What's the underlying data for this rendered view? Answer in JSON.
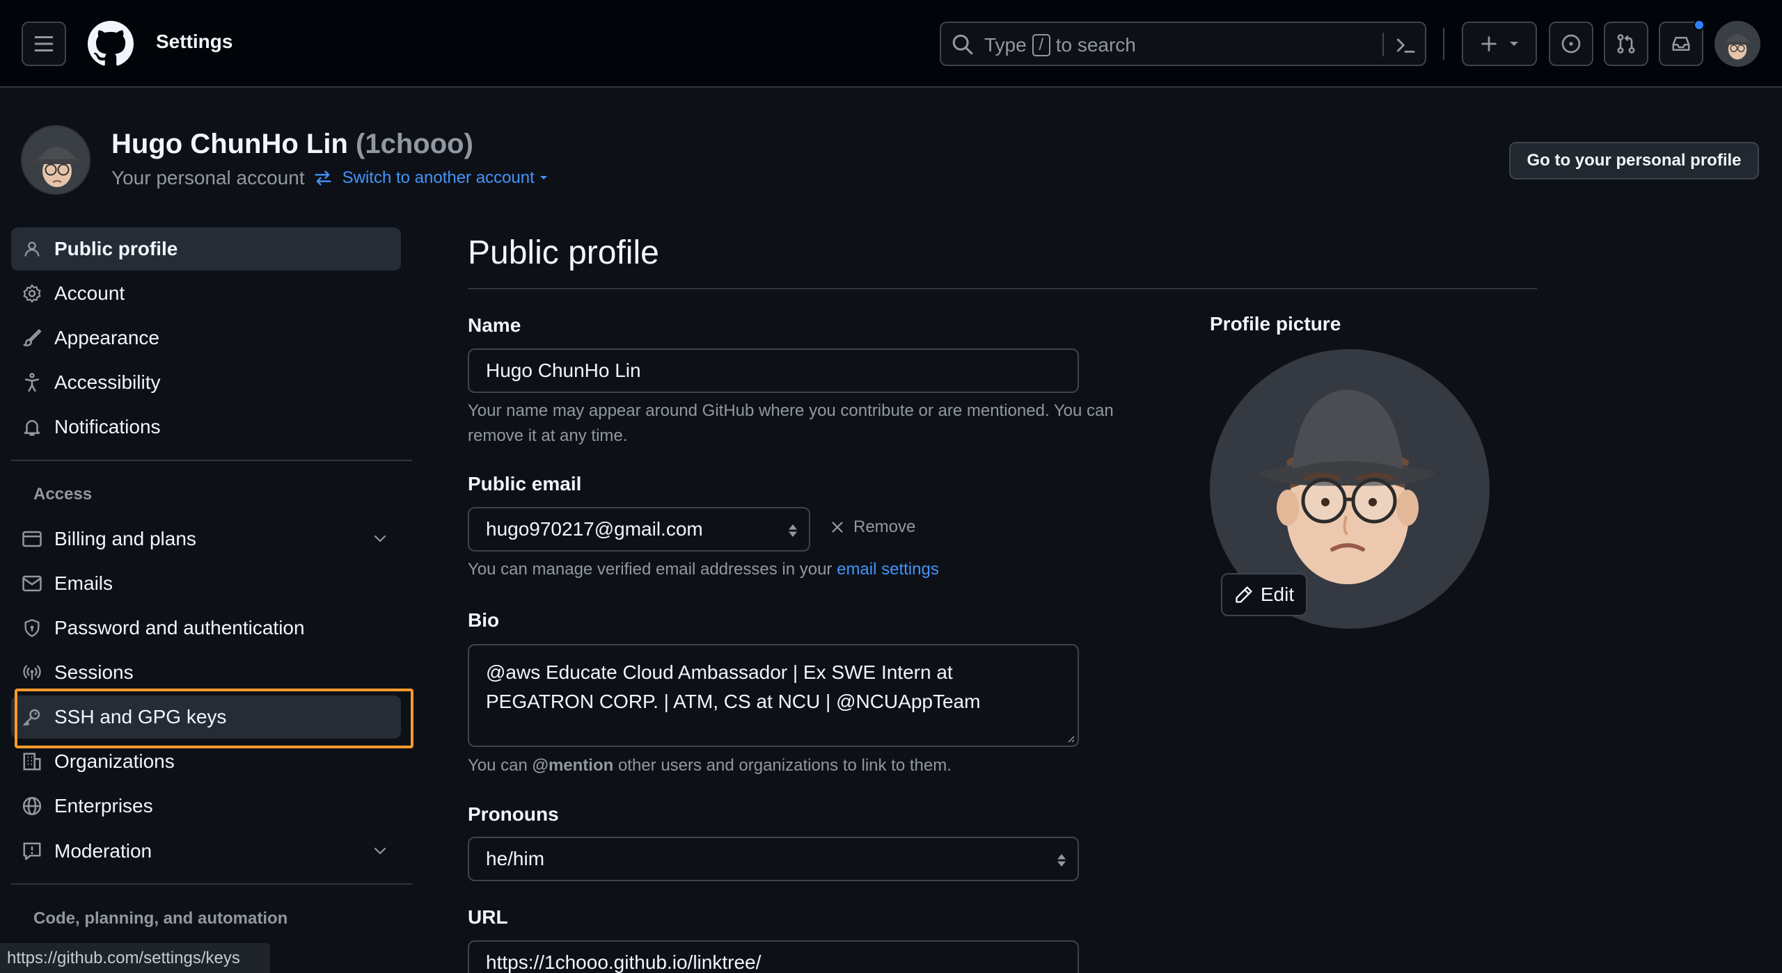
{
  "header": {
    "app_title": "Settings",
    "search_prefix": "Type",
    "search_key": "/",
    "search_suffix": "to search",
    "icons": [
      "menu-icon",
      "github-logo-icon",
      "search-icon",
      "command-palette-icon",
      "plus-icon",
      "issues-icon",
      "pull-requests-icon",
      "inbox-icon"
    ]
  },
  "account": {
    "name": "Hugo ChunHo Lin",
    "handle": "(1chooo)",
    "subtitle": "Your personal account",
    "switch_label": "Switch to another account",
    "profile_button": "Go to your personal profile"
  },
  "sidebar": {
    "items": [
      {
        "label": "Public profile",
        "icon": "person-icon"
      },
      {
        "label": "Account",
        "icon": "gear-icon"
      },
      {
        "label": "Appearance",
        "icon": "paintbrush-icon"
      },
      {
        "label": "Accessibility",
        "icon": "accessibility-icon"
      },
      {
        "label": "Notifications",
        "icon": "bell-icon"
      }
    ],
    "access_heading": "Access",
    "access_items": [
      {
        "label": "Billing and plans",
        "icon": "credit-card-icon"
      },
      {
        "label": "Emails",
        "icon": "mail-icon"
      },
      {
        "label": "Password and authentication",
        "icon": "shield-icon"
      },
      {
        "label": "Sessions",
        "icon": "broadcast-icon"
      },
      {
        "label": "SSH and GPG keys",
        "icon": "key-icon"
      },
      {
        "label": "Organizations",
        "icon": "organization-icon"
      },
      {
        "label": "Enterprises",
        "icon": "globe-icon"
      },
      {
        "label": "Moderation",
        "icon": "report-icon"
      }
    ],
    "code_heading": "Code, planning, and automation"
  },
  "main": {
    "title": "Public profile",
    "name_label": "Name",
    "name_value": "Hugo ChunHo Lin",
    "name_note": "Your name may appear around GitHub where you contribute or are mentioned. You can remove it at any time.",
    "email_label": "Public email",
    "email_value": "hugo970217@gmail.com",
    "remove_label": "Remove",
    "email_note_prefix": "You can manage verified email addresses in your",
    "email_note_link": "email settings",
    "bio_label": "Bio",
    "bio_line1": "@aws Educate Cloud Ambassador | Ex SWE Intern at",
    "bio_line2": "PEGATRON CORP. | ATM, CS at NCU | @NCUAppTeam",
    "bio_note_prefix": "You can",
    "bio_note_mention": "@mention",
    "bio_note_suffix": "other users and organizations to link to them.",
    "pronouns_label": "Pronouns",
    "pronouns_value": "he/him",
    "url_label": "URL",
    "url_value": "https://1chooo.github.io/linktree/"
  },
  "profile_picture": {
    "label": "Profile picture",
    "edit_label": "Edit"
  },
  "statusbar": {
    "url": "https://github.com/settings/keys"
  },
  "colors": {
    "accent_link": "#4493f8",
    "highlight_box": "#f59b2a",
    "active_bar": "#1f6feb"
  }
}
